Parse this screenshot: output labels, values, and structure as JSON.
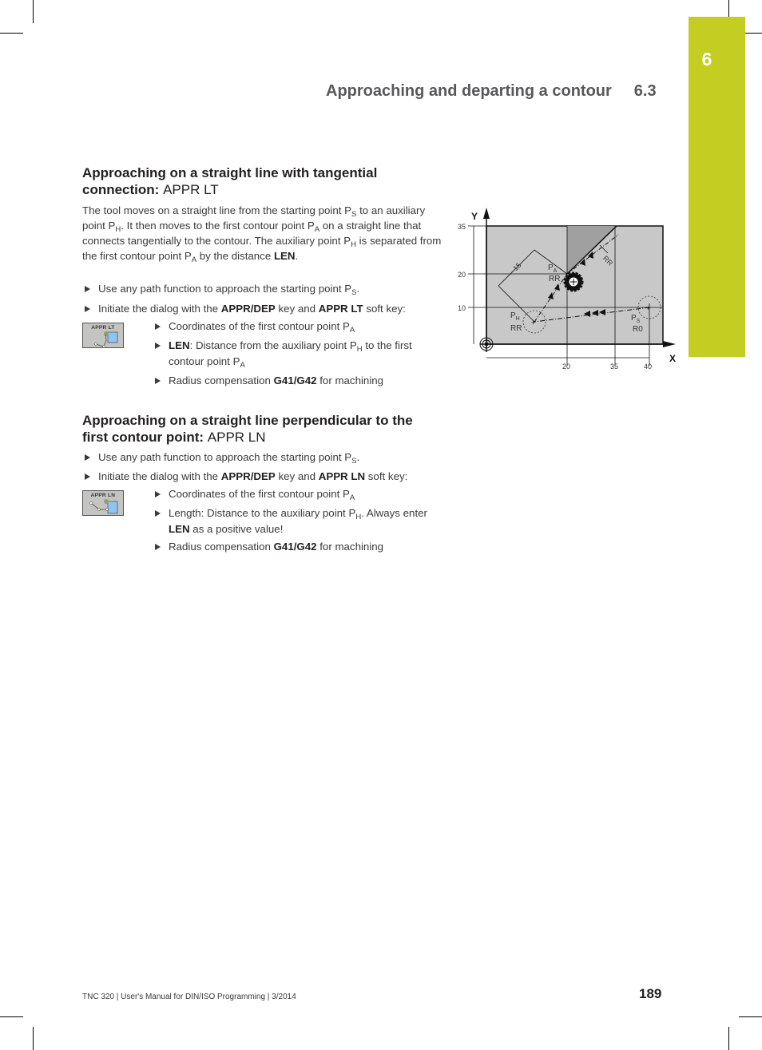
{
  "chapter": {
    "number": "6",
    "tab_color": "#c3cd22"
  },
  "running_head": {
    "title": "Approaching and departing a contour",
    "section": "6.3"
  },
  "section_lt": {
    "heading_bold": "Approaching on a straight line with tangential connection:",
    "heading_code": "APPR LT",
    "intro": {
      "t1": "The tool moves on a straight line from the starting point P",
      "s1": "S",
      "t2": " to an auxiliary point P",
      "s2": "H",
      "t3": ". It then moves to the first contour point P",
      "s3": "A",
      "t4": " on a straight line that connects tangentially to the contour. The auxiliary point P",
      "s4": "H",
      "t5": " is separated from the first contour point P",
      "s5": "A",
      "t6": " by the distance ",
      "b1": "LEN",
      "t7": "."
    },
    "steps": [
      {
        "text": "Use any path function to approach the starting point P",
        "sub": "S",
        "end": "."
      },
      {
        "pre": "Initiate the dialog with the ",
        "key": "APPR/DEP",
        "mid": " key and ",
        "softkey": "APPR LT",
        "end": " soft key:"
      }
    ],
    "softkey_label": "APPR  LT",
    "substeps": [
      {
        "text": "Coordinates of the first contour point P",
        "sub": "A"
      },
      {
        "bold": "LEN",
        "text": ": Distance from the auxiliary point P",
        "sub": "H",
        "text2": " to the first contour point P",
        "sub2": "A"
      },
      {
        "text": "Radius compensation ",
        "bold": "G41/G42",
        "text2": " for machining"
      }
    ]
  },
  "section_ln": {
    "heading_bold": "Approaching on a straight line perpendicular to the first contour point:",
    "heading_code": "APPR LN",
    "steps": [
      {
        "text": "Use any path function to approach the starting point P",
        "sub": "S",
        "end": "."
      },
      {
        "pre": "Initiate the dialog with the ",
        "key": "APPR/DEP",
        "mid": " key and ",
        "softkey": "APPR LN",
        "end": " soft key:"
      }
    ],
    "softkey_label": "APPR  LN",
    "substeps": [
      {
        "text": "Coordinates of the first contour point P",
        "sub": "A"
      },
      {
        "text": "Length: Distance to the auxiliary point P",
        "sub": "H",
        "text2": ". Always enter ",
        "bold": "LEN",
        "text3": " as a positive value!"
      },
      {
        "text": "Radius compensation ",
        "bold": "G41/G42",
        "text2": " for machining"
      }
    ]
  },
  "diagram": {
    "axis_x": "X",
    "axis_y": "Y",
    "y_ticks": [
      "35",
      "20",
      "10"
    ],
    "x_ticks": [
      "20",
      "35",
      "40"
    ],
    "len_label": "15",
    "pa_label": "P",
    "pa_sub": "A",
    "pa_comp": "RR",
    "ph_label": "P",
    "ph_sub": "H",
    "ph_comp": "RR",
    "ps_label": "P",
    "ps_sub": "S",
    "ps_comp": "R0",
    "offset_label": "RR",
    "colors": {
      "workpiece": "#c8c8c8",
      "contour_area": "#a0a0a0"
    }
  },
  "footer": {
    "text": "TNC 320 | User's Manual for DIN/ISO Programming | 3/2014",
    "page": "189"
  }
}
